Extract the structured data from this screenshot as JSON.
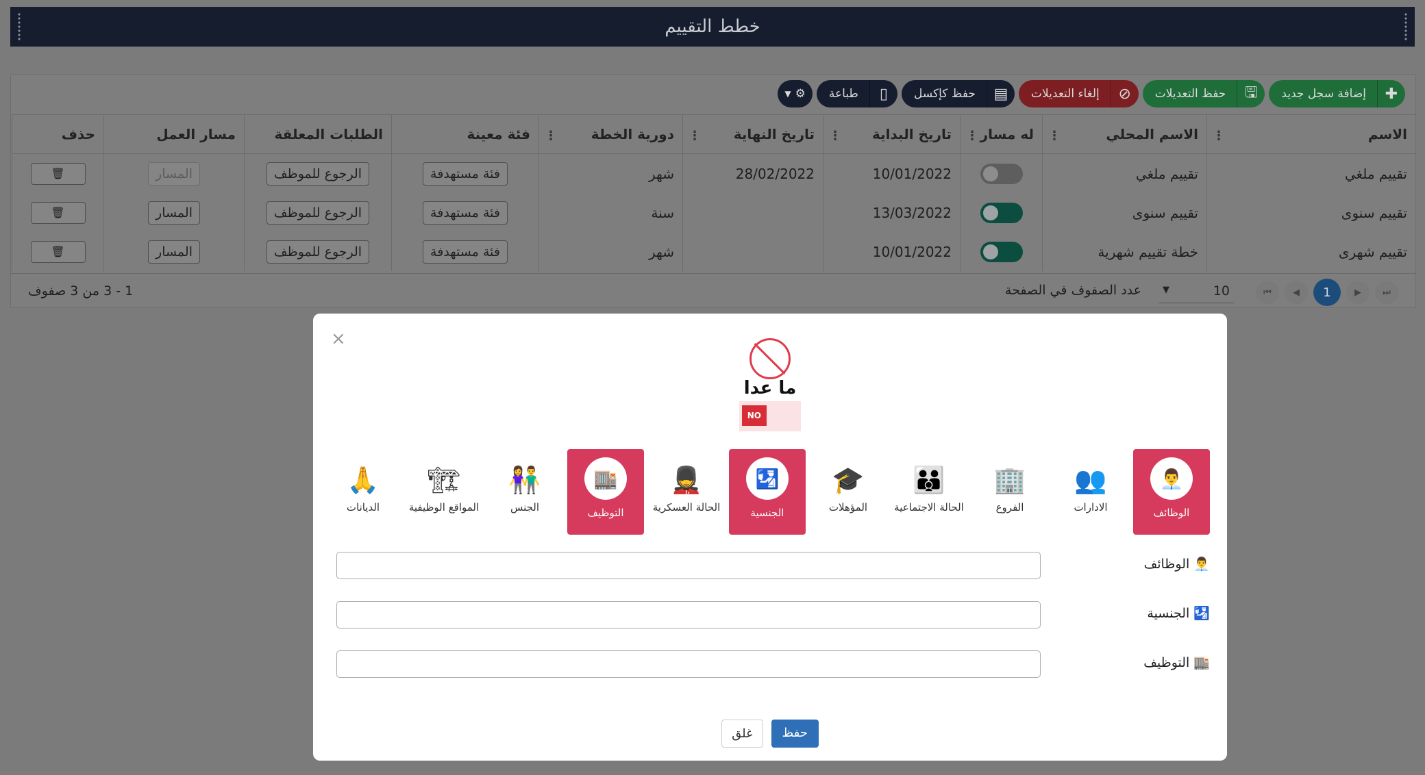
{
  "window": {
    "title": "خطط التقييم"
  },
  "toolbar": {
    "add_label": "إضافة سجل جديد",
    "save_label": "حفظ التعديلات",
    "cancel_label": "إلغاء التعديلات",
    "excel_label": "حفظ كإكسل",
    "print_label": "طباعة"
  },
  "grid": {
    "columns": [
      "الاسم",
      "الاسم المحلي",
      "له مسار",
      "تاريخ البداية",
      "تاريخ النهاية",
      "دورية الخطة",
      "فئة معينة",
      "الطلبات المعلقة",
      "مسار العمل",
      "حذف"
    ],
    "rows": [
      {
        "name": "تقييم ملغي",
        "local_name": "تقييم ملغي",
        "has_path": false,
        "start": "10/01/2022",
        "end": "28/02/2022",
        "period": "شهر",
        "category_btn": "فئة مستهدفة",
        "pending_btn": "الرجوع للموظف",
        "path_btn": "المسار"
      },
      {
        "name": "تقييم سنوى",
        "local_name": "تقييم سنوى",
        "has_path": true,
        "start": "13/03/2022",
        "end": "",
        "period": "سنة",
        "category_btn": "فئة مستهدفة",
        "pending_btn": "الرجوع للموظف",
        "path_btn": "المسار"
      },
      {
        "name": "تقييم شهرى",
        "local_name": "خطة تقييم شهرية",
        "has_path": true,
        "start": "10/01/2022",
        "end": "",
        "period": "شهر",
        "category_btn": "فئة مستهدفة",
        "pending_btn": "الرجوع للموظف",
        "path_btn": "المسار"
      }
    ],
    "delete_icon": "trash-icon",
    "pager": {
      "current_page": "1",
      "page_size": "10",
      "page_size_label": "عدد الصفوف في الصفحة",
      "info": "1 - 3 من 3 صفوف"
    }
  },
  "modal": {
    "hero_title": "ما عدا",
    "no_badge": "NO",
    "categories": [
      {
        "label": "الوظائف",
        "selected": true,
        "icon": "employee-icon"
      },
      {
        "label": "الادارات",
        "selected": false,
        "icon": "org-chart-icon"
      },
      {
        "label": "الفروع",
        "selected": false,
        "icon": "branches-icon"
      },
      {
        "label": "الحالة الاجتماعية",
        "selected": false,
        "icon": "family-icon"
      },
      {
        "label": "المؤهلات",
        "selected": false,
        "icon": "graduation-cap-icon"
      },
      {
        "label": "الجنسية",
        "selected": true,
        "icon": "passport-icon"
      },
      {
        "label": "الحالة العسكرية",
        "selected": false,
        "icon": "soldier-icon"
      },
      {
        "label": "التوظيف",
        "selected": true,
        "icon": "building-icon"
      },
      {
        "label": "الجنس",
        "selected": false,
        "icon": "gender-icon"
      },
      {
        "label": "المواقع الوظيفية",
        "selected": false,
        "icon": "hierarchy-icon"
      },
      {
        "label": "الديانات",
        "selected": false,
        "icon": "praying-hands-icon"
      }
    ],
    "fields": [
      {
        "label": "الوظائف",
        "value": ""
      },
      {
        "label": "الجنسية",
        "value": ""
      },
      {
        "label": "التوظيف",
        "value": ""
      }
    ],
    "save_label": "حفظ",
    "close_label": "غلق",
    "colors": {
      "selected": "#d63a5c",
      "save": "#2f6fb7",
      "no_badge": "#d72d37"
    }
  }
}
